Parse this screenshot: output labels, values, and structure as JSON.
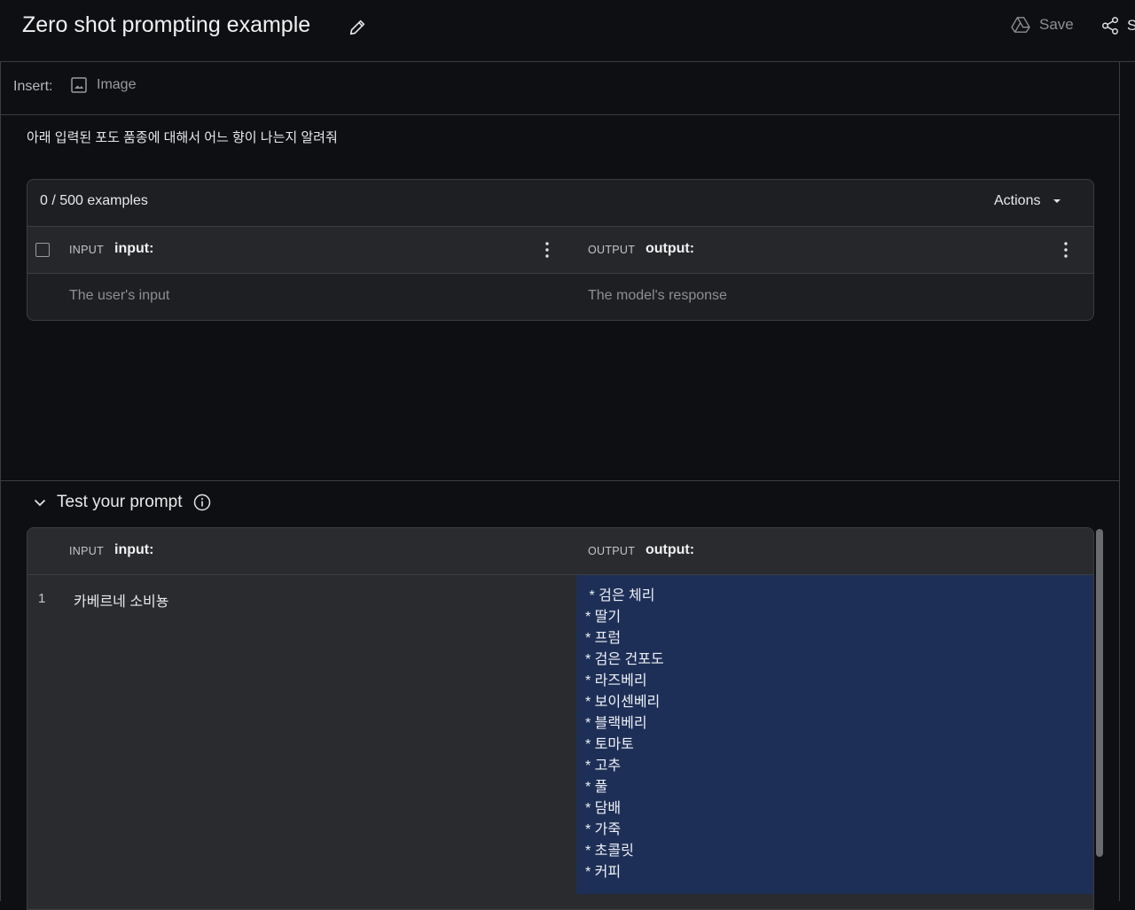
{
  "header": {
    "title": "Zero shot prompting example",
    "save_label": "Save",
    "share_label": "S"
  },
  "insert": {
    "label": "Insert:",
    "image_label": "Image"
  },
  "prompt": {
    "instruction": "아래 입력된 포도 품종에 대해서 어느 향이 나는지 알려줘"
  },
  "examples": {
    "count": "0 / 500 examples",
    "actions_label": "Actions",
    "input_tag": "INPUT",
    "input_name": "input:",
    "output_tag": "OUTPUT",
    "output_name": "output:",
    "input_placeholder": "The user's input",
    "output_placeholder": "The model's response"
  },
  "test": {
    "title": "Test your prompt",
    "input_tag": "INPUT",
    "input_name": "input:",
    "output_tag": "OUTPUT",
    "output_name": "output:",
    "row_number": "1",
    "input_value": "카베르네 소비뇽",
    "output_value": " * 검은 체리\n* 딸기\n* 프럼\n* 검은 건포도\n* 라즈베리\n* 보이센베리\n* 블랙베리\n* 토마토\n* 고추\n* 풀\n* 담배\n* 가죽\n* 초콜릿\n* 커피"
  }
}
